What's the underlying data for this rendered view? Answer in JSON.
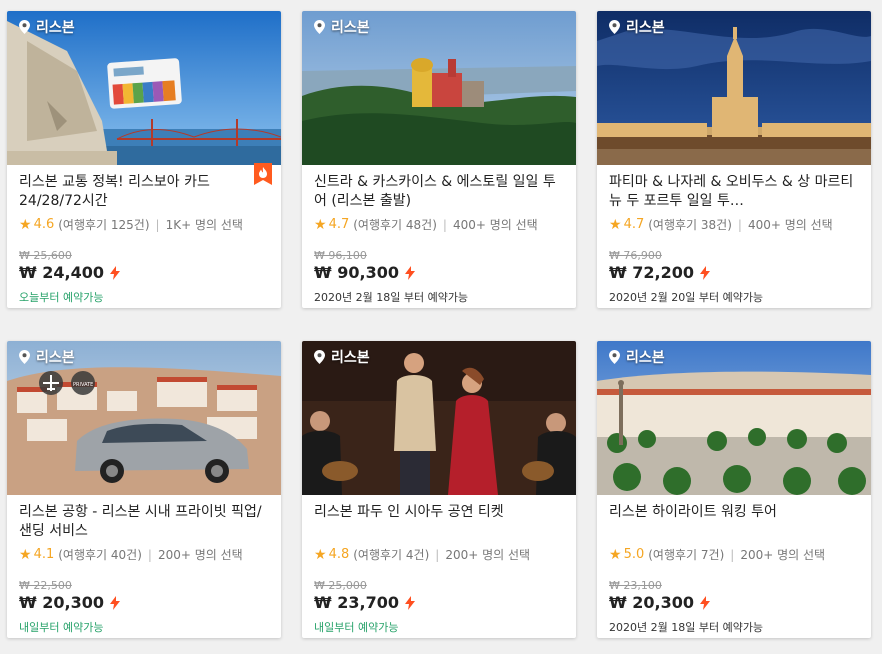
{
  "colors": {
    "star": "#f5a623",
    "bolt": "#ff4f1f",
    "available_green": "#26a269",
    "badge": "#ff5b1f"
  },
  "cards": [
    {
      "location": "리스본",
      "title": "리스본 교통 정복! 리스보아 카드 24/28/72시간",
      "rating": "4.6",
      "reviews": "(여행후기 125건)",
      "selections": "1K+ 명의 선택",
      "original_price": "₩ 25,600",
      "price": "₩ 24,400",
      "availability": "오늘부터 예약가능",
      "availability_style": "green",
      "badge": "hot-badge-icon",
      "card_label": "card"
    },
    {
      "location": "리스본",
      "title": "신트라 & 카스카이스 & 에스토릴 일일 투어 (리스본 출발)",
      "rating": "4.7",
      "reviews": "(여행후기 48건)",
      "selections": "400+ 명의 선택",
      "original_price": "₩ 96,100",
      "price": "₩ 90,300",
      "availability": "2020년 2월 18일 부터 예약가능",
      "availability_style": "dark"
    },
    {
      "location": "리스본",
      "title": "파티마 & 나자레 & 오비두스 & 상 마르티뉴 두 포르투 일일 투…",
      "rating": "4.7",
      "reviews": "(여행후기 38건)",
      "selections": "400+ 명의 선택",
      "original_price": "₩ 76,900",
      "price": "₩ 72,200",
      "availability": "2020년 2월 20일 부터 예약가능",
      "availability_style": "dark"
    },
    {
      "location": "리스본",
      "title": "리스본 공항 - 리스본 시내 프라이빗 픽업/샌딩 서비스",
      "rating": "4.1",
      "reviews": "(여행후기 40건)",
      "selections": "200+ 명의 선택",
      "original_price": "₩ 22,500",
      "price": "₩ 20,300",
      "availability": "내일부터 예약가능",
      "availability_style": "green",
      "private_label": "PRIVATE"
    },
    {
      "location": "리스본",
      "title": "리스본 파두 인 시아두 공연 티켓",
      "rating": "4.8",
      "reviews": "(여행후기 4건)",
      "selections": "200+ 명의 선택",
      "original_price": "₩ 25,000",
      "price": "₩ 23,700",
      "availability": "내일부터 예약가능",
      "availability_style": "green"
    },
    {
      "location": "리스본",
      "title": "리스본 하이라이트 워킹 투어",
      "rating": "5.0",
      "reviews": "(여행후기 7건)",
      "selections": "200+ 명의 선택",
      "original_price": "₩ 23,100",
      "price": "₩ 20,300",
      "availability": "2020년 2월 18일 부터 예약가능",
      "availability_style": "dark"
    }
  ]
}
